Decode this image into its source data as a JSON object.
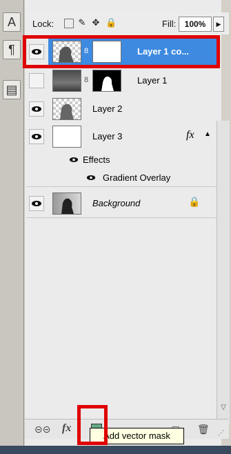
{
  "left_tools": [
    "A",
    "¶",
    "▤"
  ],
  "lock": {
    "label": "Lock:",
    "fill_label": "Fill:",
    "fill_value": "100%"
  },
  "layers": [
    {
      "name": "Layer 1 co...",
      "selected": true
    },
    {
      "name": "Layer 1"
    },
    {
      "name": "Layer 2"
    },
    {
      "name": "Layer 3",
      "fx": "fx"
    },
    {
      "name": "Effects"
    },
    {
      "name": "Gradient Overlay"
    },
    {
      "name": "Background"
    }
  ],
  "bottom": {
    "tooltip": "Add vector mask",
    "fx": "fx"
  },
  "colors": {
    "selected_row": "#3d8ae0",
    "highlight": "#e00000"
  }
}
